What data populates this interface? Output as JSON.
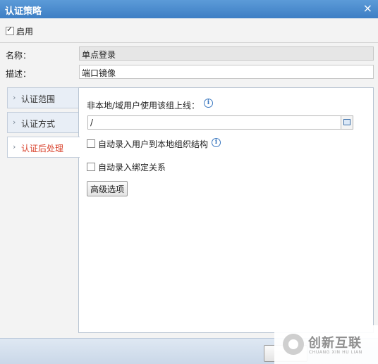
{
  "window": {
    "title": "认证策略",
    "close_glyph": "×"
  },
  "enable": {
    "label": "启用",
    "checked": true
  },
  "form": {
    "name_label": "名称：",
    "name_value": "单点登录",
    "desc_label": "描述：",
    "desc_value": "端口镜像"
  },
  "sidebar": {
    "items": [
      {
        "label": "认证范围",
        "active": false
      },
      {
        "label": "认证方式",
        "active": false
      },
      {
        "label": "认证后处理",
        "active": true
      }
    ]
  },
  "panel": {
    "offline_label": "非本地/域用户使用该组上线：",
    "path_value": "/",
    "auto_import_label": "自动录入用户到本地组织结构",
    "auto_import_checked": false,
    "auto_bind_label": "自动录入绑定关系",
    "auto_bind_checked": false,
    "advanced_button": "高级选项"
  },
  "watermark": {
    "brand": "创新互联",
    "sub": "CHUANG XIN HU LIAN"
  },
  "icons": {
    "info": "info-icon",
    "browse": "folder-browse-icon",
    "chevron": "chevron-right-icon"
  }
}
